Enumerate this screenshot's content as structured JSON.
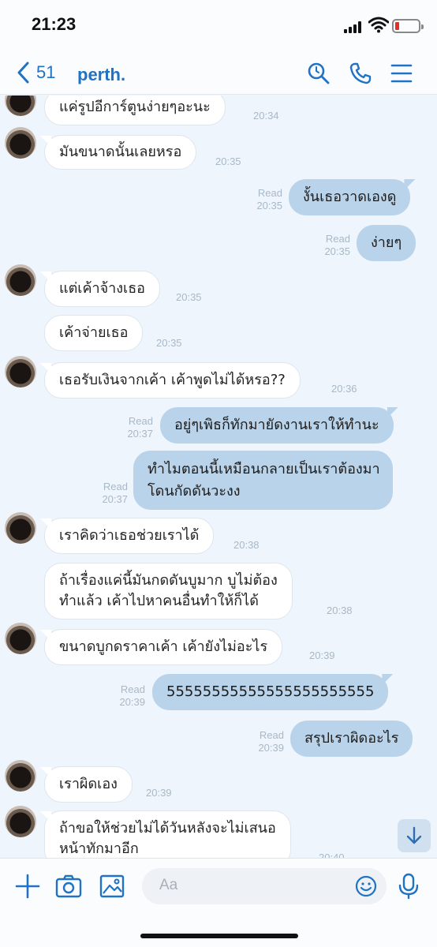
{
  "status": {
    "time": "21:23"
  },
  "header": {
    "back_count": "51",
    "title": "perth."
  },
  "messages": [
    {
      "text": "แค่รูปอีการ์ตูนง่ายๆอะนะ",
      "time": "20:34"
    },
    {
      "text": "มันขนาดนั้นเลยหรอ",
      "time": "20:35"
    },
    {
      "text": "งั้นเธอวาดเองดู",
      "read": "Read",
      "time": "20:35"
    },
    {
      "text": "ง่ายๆ",
      "read": "Read",
      "time": "20:35"
    },
    {
      "text": "แต่เค้าจ้างเธอ",
      "time": "20:35"
    },
    {
      "text": "เค้าจ่ายเธอ",
      "time": "20:35"
    },
    {
      "text": "เธอรับเงินจากเค้า เค้าพูดไม่ได้หรอ??",
      "time": "20:36"
    },
    {
      "text": "อยู่ๆเพิธก็ทักมายัดงานเราให้ทำนะ",
      "read": "Read",
      "time": "20:37"
    },
    {
      "line1": "ทำไมตอนนี้เหมือนกลายเป็นเราต้องมา",
      "line2": "โดนกัดดันวะงง",
      "read": "Read",
      "time": "20:37"
    },
    {
      "text": "เราคิดว่าเธอช่วยเราได้",
      "time": "20:38"
    },
    {
      "line1": "ถ้าเรื่องแค่นี้มันกดดันบูมาก บูไม่ต้อง",
      "line2": "ทำแล้ว เค้าไปหาคนอื่นทำให้ก็ได้",
      "time": "20:38"
    },
    {
      "text": "ขนาดบูกดราคาเค้า เค้ายังไม่อะไร",
      "time": "20:39"
    },
    {
      "text": "55555555555555555555555",
      "read": "Read",
      "time": "20:39"
    },
    {
      "text": "สรุปเราผิดอะไร",
      "read": "Read",
      "time": "20:39"
    },
    {
      "text": "เราผิดเอง",
      "time": "20:39"
    },
    {
      "line1": "ถ้าขอให้ช่วยไม่ได้วันหลังจะไม่เสนอ",
      "line2": "หน้าทักมาอีก",
      "time": "20:40"
    }
  ],
  "input": {
    "placeholder": "Aa"
  },
  "colors": {
    "accent": "#1f72c4",
    "bubble_out": "#b9d3ea",
    "bubble_in": "#ffffff",
    "chat_bg": "#eef5fc"
  },
  "icons": [
    "back-chevron-icon",
    "search-icon",
    "phone-icon",
    "menu-icon",
    "plus-icon",
    "camera-icon",
    "image-icon",
    "emoji-icon",
    "microphone-icon",
    "arrow-down-icon"
  ]
}
